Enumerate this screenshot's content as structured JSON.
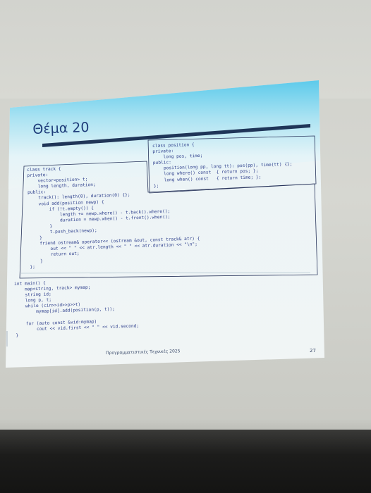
{
  "slide": {
    "title": "Θέμα 20",
    "position_class_code": "class position {\nprivate:\n    long pos, time;\npublic:\n    position(long pp, long tt): pos(pp), time(tt) {};\n    long where() const  { return pos; };\n    long when() const   { return time; };\n};",
    "track_class_code": "class track {\nprivate:\n    vector<position> t;\n    long length, duration;\npublic:\n    track(): length(0), duration(0) {};\n    void add(position newp) {\n        if (!t.empty()) {\n            length += newp.where() - t.back().where();\n            duration = newp.when() - t.front().when();\n        }\n        t.push_back(newp);\n    }\n    friend ostream& operator<< (ostream &out, const track& atr) {\n        out << \" \" << atr.length << \" \" << atr.duration << \"\\n\";\n        return out;\n    }\n};",
    "main_code": "int main() {\n    map<string, track> mymap;\n    string id;\n    long p, t;\n    while (cin>>id>>p>>t)\n        mymap[id].add(position(p, t));\n\n    for (auto const &vid:mymap)\n        cout << vid.first << \" \" << vid.second;\n}",
    "footer": "Προγραμματιστικές Τεχνικές 2025",
    "page_number": "27"
  }
}
